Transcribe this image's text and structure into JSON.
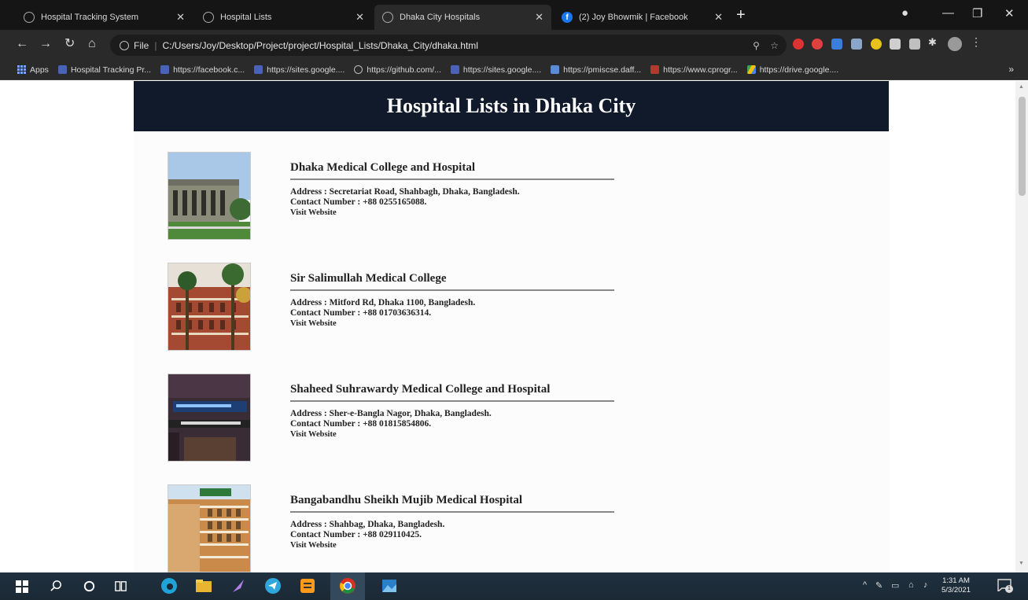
{
  "browser": {
    "tabs": [
      {
        "title": "Hospital Tracking System",
        "active": false
      },
      {
        "title": "Hospital Lists",
        "active": false
      },
      {
        "title": "Dhaka City Hospitals",
        "active": true
      },
      {
        "title": "(2) Joy Bhowmik | Facebook",
        "active": false
      }
    ],
    "address": {
      "scheme_label": "File",
      "url": "C:/Users/Joy/Desktop/Project/project/Hospital_Lists/Dhaka_City/dhaka.html"
    },
    "bookmarks": [
      {
        "label": "Apps",
        "icon": "apps-grid-icon"
      },
      {
        "label": "Hospital Tracking Pr...",
        "icon": "site-icon"
      },
      {
        "label": "https://facebook.c...",
        "icon": "site-icon"
      },
      {
        "label": "https://sites.google....",
        "icon": "site-icon"
      },
      {
        "label": "https://github.com/...",
        "icon": "github-icon"
      },
      {
        "label": "https://sites.google....",
        "icon": "site-icon"
      },
      {
        "label": "https://pmiscse.daff...",
        "icon": "site-icon"
      },
      {
        "label": "https://www.cprogr...",
        "icon": "site-icon"
      },
      {
        "label": "https://drive.google....",
        "icon": "drive-icon"
      }
    ],
    "bookmarks_overflow": "»"
  },
  "page": {
    "title": "Hospital Lists in Dhaka City",
    "hospitals": [
      {
        "name": "Dhaka Medical College and Hospital",
        "address": "Address : Secretariat Road, Shahbagh, Dhaka, Bangladesh.",
        "contact": "Contact Number : +88 0255165088.",
        "link": "Visit Website"
      },
      {
        "name": "Sir Salimullah Medical College",
        "address": "Address : Mitford Rd, Dhaka 1100, Bangladesh.",
        "contact": "Contact Number : +88 01703636314.",
        "link": "Visit Website"
      },
      {
        "name": "Shaheed Suhrawardy Medical College and Hospital",
        "address": "Address : Sher-e-Bangla Nagor, Dhaka, Bangladesh.",
        "contact": "Contact Number : +88 01815854806.",
        "link": "Visit Website"
      },
      {
        "name": "Bangabandhu Sheikh Mujib Medical Hospital",
        "address": "Address : Shahbag, Dhaka, Bangladesh.",
        "contact": "Contact Number : +88 029110425.",
        "link": "Visit Website"
      }
    ]
  },
  "taskbar": {
    "time": "1:31 AM",
    "date": "5/3/2021",
    "notifications": "1"
  },
  "colors": {
    "header_bg": "#101a2a",
    "tab_bg": "#151515",
    "toolbar_bg": "#2a2a2a",
    "taskbar_bg": "#1b2935"
  }
}
